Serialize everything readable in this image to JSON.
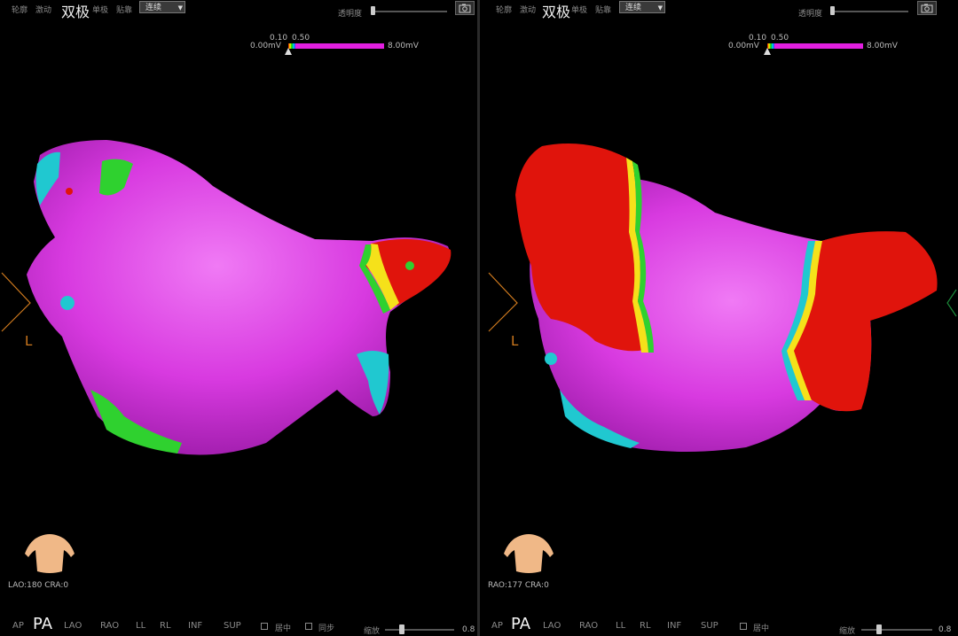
{
  "panels": [
    {
      "toolbar": {
        "items": [
          "轮廓",
          "激动",
          "双极",
          "单极",
          "贴靠"
        ],
        "active_item": "双极",
        "mode_select": "连续",
        "opacity_label": "透明度",
        "opacity_level": 0.0
      },
      "voltage_scale": {
        "tick_low": "0.10",
        "tick_high": "0.50",
        "min": "0.00mV",
        "max": "8.00mV"
      },
      "orientation_marker": "L",
      "view_readout": "LAO:180 CRA:0",
      "view_buttons": [
        "AP",
        "PA",
        "LAO",
        "RAO",
        "LL",
        "RL",
        "INF",
        "SUP"
      ],
      "active_view": "PA",
      "checkboxes": [
        "居中",
        "同步"
      ],
      "zoom_label": "缩放",
      "zoom_value": "0.8"
    },
    {
      "toolbar": {
        "items": [
          "轮廓",
          "激动",
          "双极",
          "单极",
          "贴靠"
        ],
        "active_item": "双极",
        "mode_select": "连续",
        "opacity_label": "透明度",
        "opacity_level": 0.0
      },
      "voltage_scale": {
        "tick_low": "0.10",
        "tick_high": "0.50",
        "min": "0.00mV",
        "max": "8.00mV"
      },
      "orientation_marker": "L",
      "view_readout": "RAO:177 CRA:0",
      "view_buttons": [
        "AP",
        "PA",
        "LAO",
        "RAO",
        "LL",
        "RL",
        "INF",
        "SUP"
      ],
      "active_view": "PA",
      "checkboxes": [
        "居中"
      ],
      "zoom_label": "缩放",
      "zoom_value": "0.8"
    }
  ],
  "colors": {
    "healthy": "#e23ae8",
    "scar": "#e0140c",
    "border_zone": [
      "#f5e11a",
      "#2fd12f",
      "#20c8d0",
      "#2255ee"
    ],
    "orientation": "#d07a1e",
    "right_arrow": "#1c8a3a"
  }
}
